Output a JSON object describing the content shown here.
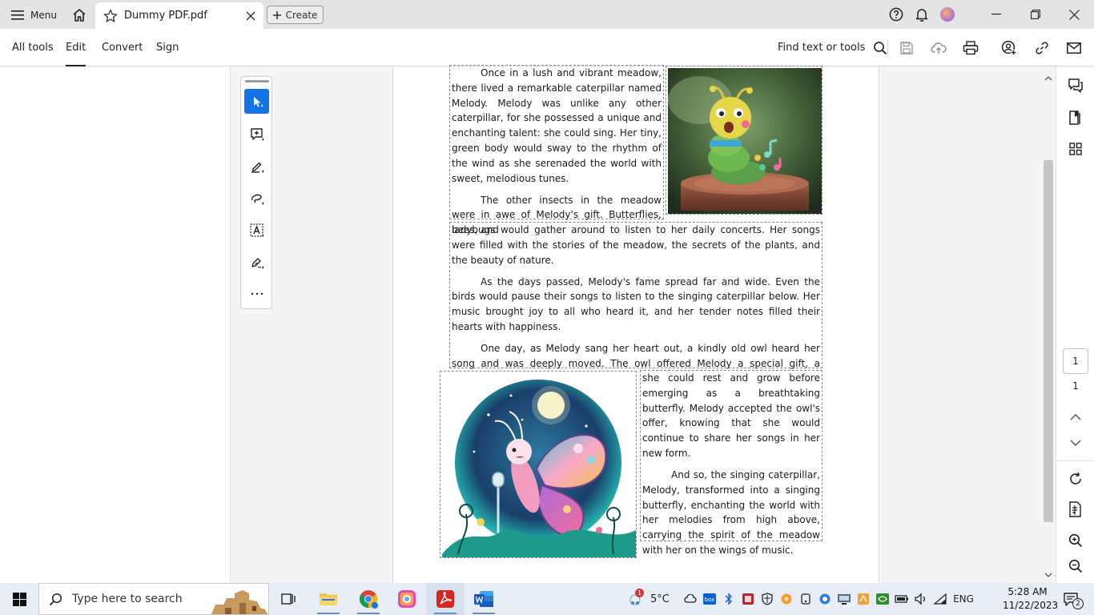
{
  "titlebar": {
    "menu_label": "Menu",
    "tab_title": "Dummy PDF.pdf",
    "create_label": "Create"
  },
  "toolbar": {
    "menu": [
      "All tools",
      "Edit",
      "Convert",
      "Sign"
    ],
    "active_menu": "Edit",
    "find_label": "Find text or tools"
  },
  "document": {
    "block1": "Once in a lush and vibrant meadow, there lived a remarkable caterpillar named Melody. Melody was unlike any other caterpillar, for she possessed a unique and enchanting talent: she could sing. Her tiny, green body would sway to the rhythm of the wind as she serenaded the world with sweet, melodious tunes.",
    "block2a": "The other insects in the meadow were in awe of Melody's gift. Butterflies, bees, and",
    "block2b": "ladybugs would gather around to listen to her daily concerts. Her songs were filled with the stories of the meadow, the secrets of the plants, and the beauty of nature.",
    "block3": "As the days passed, Melody's fame spread far and wide. Even the birds would pause their songs to listen to the singing caterpillar below. Her music brought joy to all who heard it, and her tender notes filled their hearts with happiness.",
    "block4": "One day, as Melody sang her heart out, a kindly old owl heard her song and was deeply moved. The owl offered Melody a special gift, a cocoon where",
    "block5": "she could rest and grow before emerging as a breathtaking butterfly. Melody accepted the owl's offer, knowing that she would continue to share her songs in her new form.",
    "block6": "And so, the singing caterpillar, Melody, transformed into a singing butterfly, enchanting the world with her melodies from high above, carrying the spirit of the meadow with her on the wings of music."
  },
  "page_nav": {
    "current": "1",
    "total": "1"
  },
  "taskbar": {
    "search_placeholder": "Type here to search",
    "weather": "5°C",
    "language": "ENG",
    "time": "5:28 AM",
    "date": "11/22/2023",
    "notification_count": "2",
    "weather_badge": "1"
  },
  "colors": {
    "accent": "#1473e6",
    "acrobat_red": "#d7261e"
  }
}
